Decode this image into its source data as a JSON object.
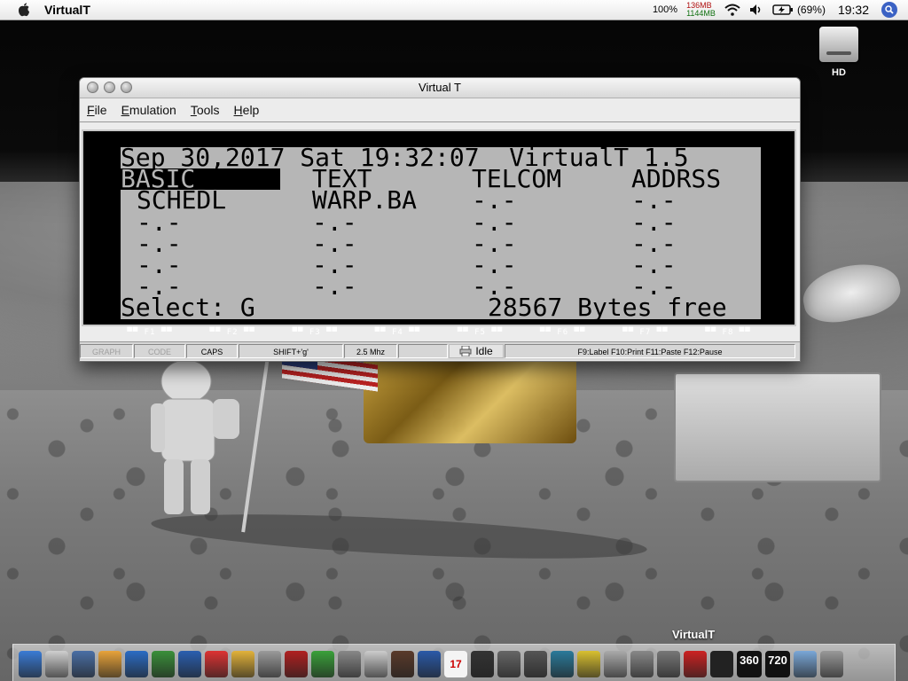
{
  "menubar": {
    "app_title": "VirtualT",
    "zoom": "100%",
    "mem_used": "136MB",
    "mem_free": "1144MB",
    "battery": "(69%)",
    "clock": "19:32"
  },
  "desktop": {
    "hd_label": "HD"
  },
  "window": {
    "title": "Virtual T",
    "menu": [
      "File",
      "Emulation",
      "Tools",
      "Help"
    ],
    "lcd": {
      "status_line": "Sep 30,2017 Sat 19:32:07  VirtualT 1.5",
      "files": [
        [
          "BASIC",
          "TEXT",
          "TELCOM",
          "ADDRSS"
        ],
        [
          "SCHEDL",
          "WARP.BA",
          "-.-",
          "-.-"
        ],
        [
          "-.-",
          "-.-",
          "-.-",
          "-.-"
        ],
        [
          "-.-",
          "-.-",
          "-.-",
          "-.-"
        ],
        [
          "-.-",
          "-.-",
          "-.-",
          "-.-"
        ],
        [
          "-.-",
          "-.-",
          "-.-",
          "-.-"
        ]
      ],
      "prompt": "Select: G_",
      "bytes_free": "28567 Bytes free",
      "fkeys": [
        "F1",
        "F2",
        "F3",
        "F4",
        "F5",
        "F6",
        "F7",
        "F8"
      ]
    },
    "statusbar": {
      "graph": "GRAPH",
      "code": "CODE",
      "caps": "CAPS",
      "shift": "SHIFT+'g'",
      "speed": "2.5 Mhz",
      "idle": "Idle",
      "hotkeys": "F9:Label  F10:Print  F11:Paste  F12:Pause"
    }
  },
  "dock": {
    "tooltip": "VirtualT",
    "tile_colors": [
      "#3a7bd5",
      "#cfcfcf",
      "#4a6fa5",
      "#e8a33a",
      "#2b6cc4",
      "#3a8f3a",
      "#2a5fb0",
      "#d33",
      "#e2b23a",
      "#9a9a9a",
      "#b02020",
      "#3aa03a",
      "#888",
      "#ccc",
      "#5a3a2a",
      "#2a5aa8",
      "#e0e0e0",
      "#333",
      "#666",
      "#555",
      "#2a7a9a",
      "#d9c030",
      "#aaa",
      "#888",
      "#777",
      "#c22",
      "#222",
      "#222",
      "#7aa7d8",
      "#7aa7d8",
      "#999"
    ],
    "counters": [
      "360",
      "720"
    ],
    "calendar_day": "17"
  }
}
